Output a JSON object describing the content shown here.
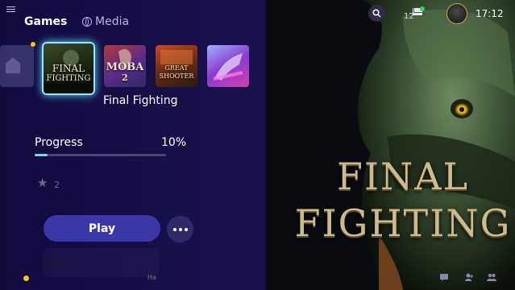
{
  "nav": {
    "games": "Games",
    "media": "Media"
  },
  "header": {
    "mail_count": "12",
    "time": "17:12"
  },
  "tiles": [
    {
      "label_top": "FINAL",
      "label_bottom": "FIGHTING"
    },
    {
      "label_top": "MOBA",
      "label_bottom": "2"
    },
    {
      "label_top": "GREAT",
      "label_bottom": "SHOOTER"
    },
    {
      "label_top": "",
      "label_bottom": ""
    }
  ],
  "selected_title": "Final Fighting",
  "progress": {
    "label": "Progress",
    "percent_text": "10%",
    "value": 0.1
  },
  "trophies": {
    "count": "2"
  },
  "actions": {
    "play": "Play"
  },
  "hero": {
    "line1": "FINAL",
    "line2": "FIGHTING"
  },
  "bottom": {
    "partial_text": "Ha"
  },
  "colors": {
    "accent": "#8fe8ff",
    "play": "#3c37a8",
    "progress_fill": "#7ad7ee",
    "notify": "#f5c518",
    "online": "#3ad06a"
  },
  "icons": [
    "menu-icon",
    "globe-icon",
    "search-icon",
    "mail-icon",
    "home-icon",
    "trophy-icon",
    "more-icon",
    "chat-icon",
    "friends-icon",
    "party-icon"
  ]
}
